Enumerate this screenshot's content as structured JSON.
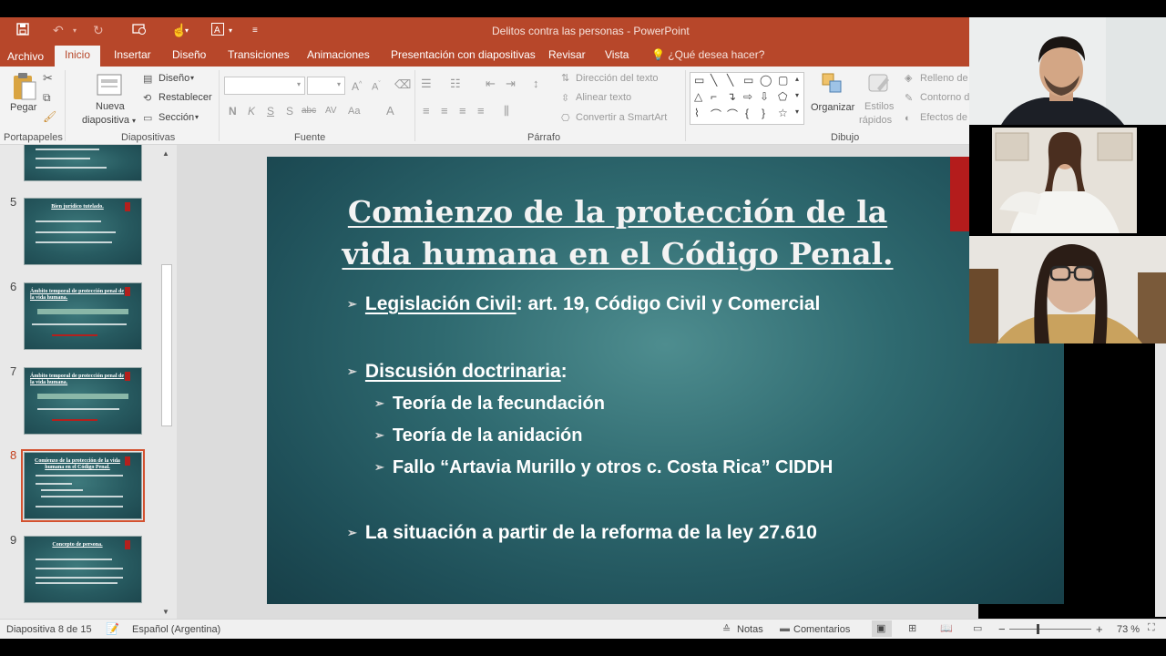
{
  "window": {
    "title": "Delitos contra las personas - PowerPoint"
  },
  "quick_access": {
    "save_icon": "save-icon",
    "undo_icon": "undo-icon",
    "redo_icon": "redo-icon"
  },
  "tabs": [
    {
      "label": "Archivo"
    },
    {
      "label": "Inicio"
    },
    {
      "label": "Insertar"
    },
    {
      "label": "Diseño"
    },
    {
      "label": "Transiciones"
    },
    {
      "label": "Animaciones"
    },
    {
      "label": "Presentación con diapositivas"
    },
    {
      "label": "Revisar"
    },
    {
      "label": "Vista"
    }
  ],
  "tell_me": "¿Qué desea hacer?",
  "ribbon": {
    "paste": "Pegar",
    "new_slide_1": "Nueva",
    "new_slide_2": "diapositiva",
    "layout": "Diseño",
    "reset": "Restablecer",
    "section": "Sección",
    "font_buttons": [
      "N",
      "K",
      "S",
      "S",
      "abc",
      "AV",
      "Aa"
    ],
    "text_direction": "Dirección del texto",
    "align_text": "Alinear texto",
    "smartart": "Convertir a SmartArt",
    "arrange": "Organizar",
    "quick_styles_1": "Estilos",
    "quick_styles_2": "rápidos",
    "shape_fill": "Relleno de",
    "shape_outline": "Contorno d",
    "shape_effects": "Efectos de",
    "groups": {
      "clipboard": "Portapapeles",
      "slides": "Diapositivas",
      "font": "Fuente",
      "paragraph": "Párrafo",
      "drawing": "Dibujo"
    }
  },
  "thumbnails": [
    {
      "num": "5",
      "title": "Bien jurídico tutelado."
    },
    {
      "num": "6",
      "title": "Ámbito temporal de protección penal de la vida humana."
    },
    {
      "num": "7",
      "title": "Ámbito temporal de protección penal de la vida humana."
    },
    {
      "num": "8",
      "title": "Comienzo de la protección de la vida humana en el Código Penal."
    },
    {
      "num": "9",
      "title": "Concepto de persona."
    }
  ],
  "slide": {
    "title_line1": "Comienzo de la protección de la",
    "title_line2": "vida humana en el Código Penal.",
    "b1_underlined": "Legislación Civil",
    "b1_rest": ": art. 19, Código Civil y Comercial",
    "b2_underlined": "Discusión doctrinaria",
    "b2_rest": ":",
    "sub1": "Teoría de la fecundación",
    "sub2": "Teoría de la anidación",
    "sub3": "Fallo “Artavia Murillo y otros c. Costa Rica” CIDDH",
    "b3": "La situación a partir de la reforma de la ley 27.610"
  },
  "status": {
    "slide_count": "Diapositiva 8 de 15",
    "language": "Español (Argentina)",
    "notes": "Notas",
    "comments": "Comentarios",
    "zoom_minus": "−",
    "zoom_plus": "+",
    "zoom": "73 %"
  }
}
